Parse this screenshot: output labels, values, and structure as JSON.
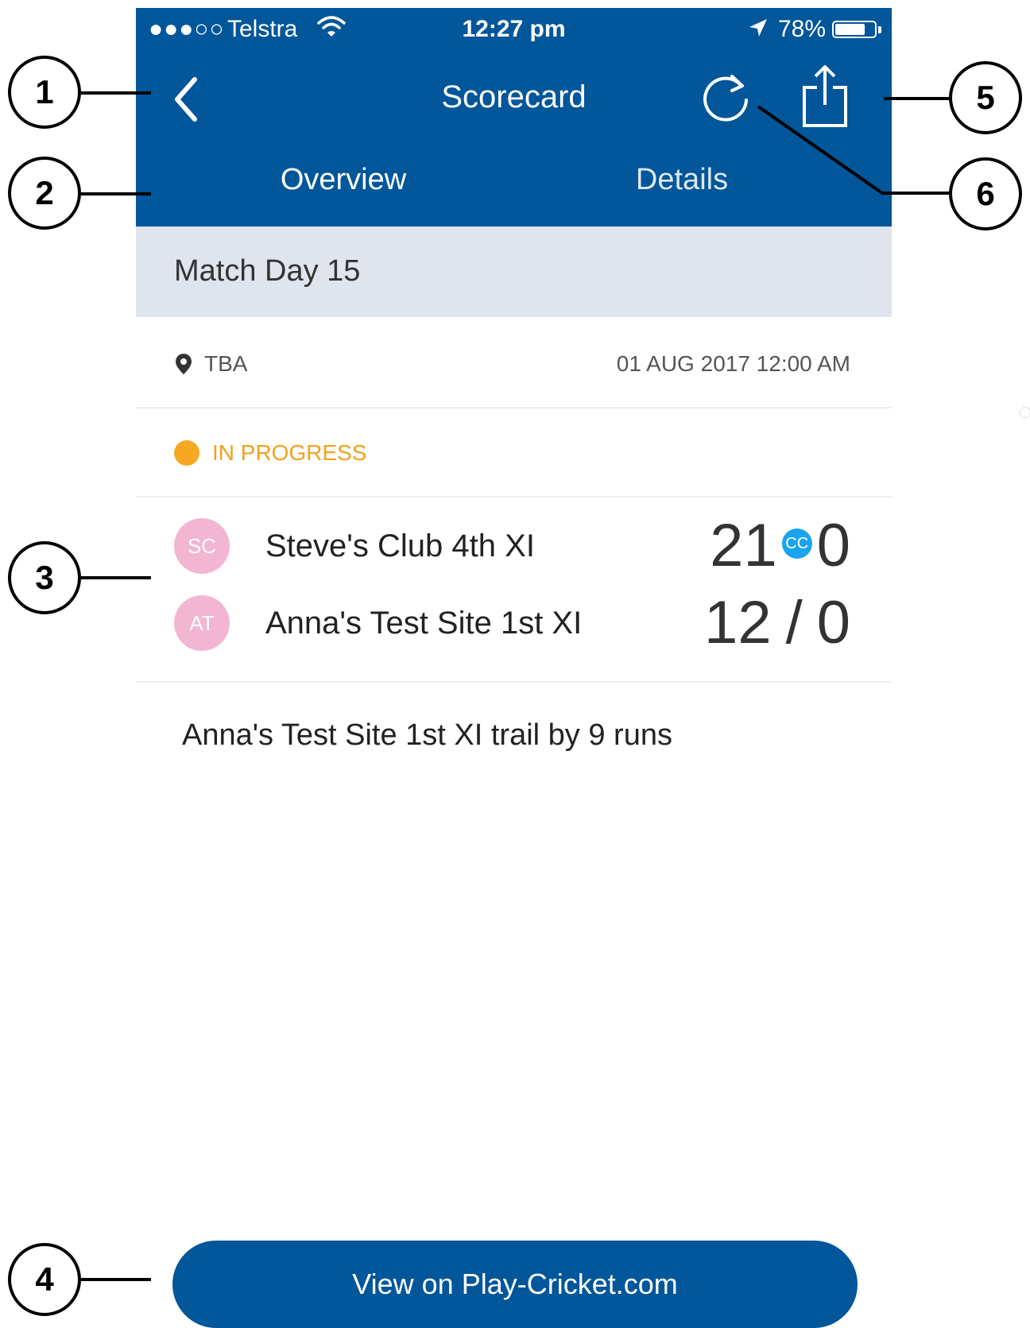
{
  "status_bar": {
    "signal": "●●●○○",
    "carrier": "Telstra",
    "time": "12:27 pm",
    "battery": "78%"
  },
  "nav": {
    "title": "Scorecard"
  },
  "tabs": [
    {
      "label": "Overview",
      "selected": true
    },
    {
      "label": "Details",
      "selected": false
    }
  ],
  "match": {
    "name": "Match Day 15",
    "venue": "TBA",
    "datetime": "01 AUG 2017 12:00 AM",
    "status": "IN PROGRESS",
    "status_color": "#f7a823",
    "teams": [
      {
        "initials": "SC",
        "name": "Steve's Club 4th XI",
        "runs": "21",
        "badge": "CC",
        "wickets": "0"
      },
      {
        "initials": "AT",
        "name": "Anna's Test Site 1st XI",
        "runs": "12",
        "separator": "/",
        "wickets": "0"
      }
    ],
    "result": "Anna's Test Site 1st XI trail by 9 runs"
  },
  "footer": {
    "button_label": "View on Play-Cricket.com"
  },
  "callouts": [
    "1",
    "2",
    "3",
    "4",
    "5",
    "6"
  ],
  "colors": {
    "brand": "#02569a",
    "tab_indicator": "#8ab1d5",
    "header_bg": "#e0e4ed",
    "avatar": "#f2b6d2",
    "badge": "#1aa3ee"
  }
}
